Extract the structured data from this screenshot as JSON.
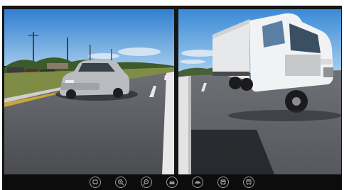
{
  "views": [
    {
      "name": "left-camera-view"
    },
    {
      "name": "right-camera-view"
    }
  ],
  "toolbar": {
    "buttons": [
      {
        "icon": "vehicle-front-icon"
      },
      {
        "icon": "zoom-in-icon"
      },
      {
        "icon": "zoom-out-icon"
      },
      {
        "icon": "car-front-icon"
      },
      {
        "icon": "car-side-icon"
      },
      {
        "icon": "bus-front-icon"
      },
      {
        "icon": "truck-front-icon"
      }
    ]
  },
  "colors": {
    "bezel": "#141414",
    "toolbar": "#0c0c0c",
    "icon": "#9a9a9a",
    "sky": "#3f8fd6",
    "road": "#5a5d62",
    "grass": "#7c8a3f"
  }
}
